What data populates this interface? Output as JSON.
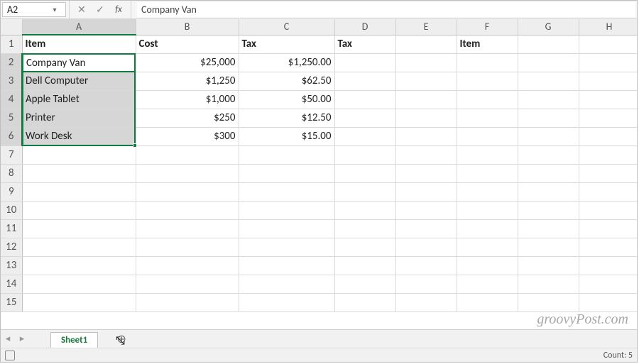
{
  "formula_bar": {
    "name_box": "A2",
    "cancel": "✕",
    "confirm": "✓",
    "fx_label": "fx",
    "formula_text": "Company Van"
  },
  "columns": [
    "A",
    "B",
    "C",
    "D",
    "E",
    "F",
    "G",
    "H"
  ],
  "row_numbers": [
    1,
    2,
    3,
    4,
    5,
    6,
    7,
    8,
    9,
    10,
    11,
    12,
    13,
    14,
    15
  ],
  "headers": {
    "A": "Item",
    "B": "Cost",
    "C": "Tax",
    "D": "Tax",
    "E": "",
    "F": "Item",
    "G": "",
    "H": ""
  },
  "rows": [
    {
      "A": "Company Van",
      "B": "$25,000",
      "C": "$1,250.00"
    },
    {
      "A": "Dell Computer",
      "B": "$1,250",
      "C": "$62.50"
    },
    {
      "A": "Apple Tablet",
      "B": "$1,000",
      "C": "$50.00"
    },
    {
      "A": "Printer",
      "B": "$250",
      "C": "$12.50"
    },
    {
      "A": "Work Desk",
      "B": "$300",
      "C": "$15.00"
    }
  ],
  "selection": {
    "range": "A2:A6",
    "active": "A2",
    "active_value": "Company Van"
  },
  "tabs": {
    "active": "Sheet1",
    "add_label": "⊕"
  },
  "status": {
    "count_label": "Count:",
    "count_value": "5"
  },
  "watermark": "groovyPost.com",
  "colors": {
    "accent": "#107c41"
  },
  "chart_data": {
    "type": "table",
    "title": "",
    "columns": [
      "Item",
      "Cost",
      "Tax"
    ],
    "data": [
      {
        "Item": "Company Van",
        "Cost": 25000,
        "Tax": 1250.0
      },
      {
        "Item": "Dell Computer",
        "Cost": 1250,
        "Tax": 62.5
      },
      {
        "Item": "Apple Tablet",
        "Cost": 1000,
        "Tax": 50.0
      },
      {
        "Item": "Printer",
        "Cost": 250,
        "Tax": 12.5
      },
      {
        "Item": "Work Desk",
        "Cost": 300,
        "Tax": 15.0
      }
    ]
  }
}
